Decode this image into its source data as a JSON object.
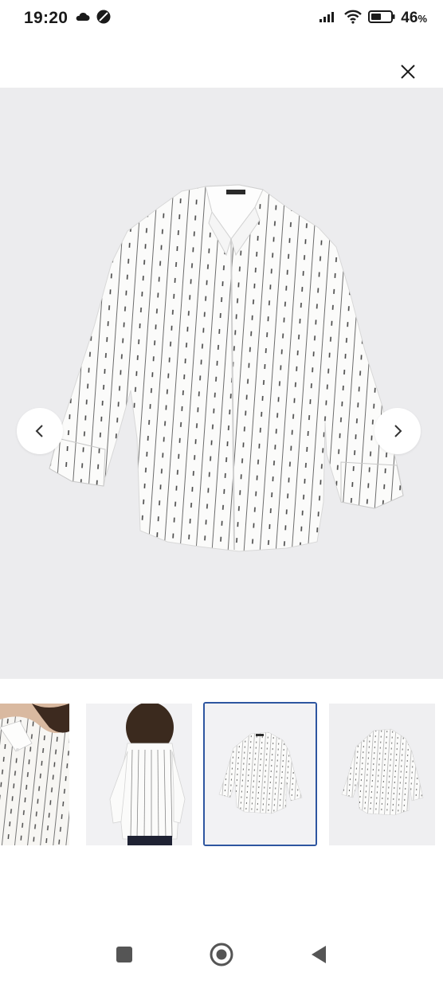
{
  "status_bar": {
    "time": "19:20",
    "battery_percent": "46",
    "battery_unit": "%"
  },
  "gallery": {
    "thumbnail_count": 4,
    "selected_thumbnail": 3
  },
  "colors": {
    "image_background": "#ececee",
    "selected_border": "#2e56a0",
    "icon_dark": "#1a1a1a"
  },
  "icons": {
    "close": "close-icon",
    "prev": "chevron-left-icon",
    "next": "chevron-right-icon",
    "home": "circle-icon",
    "recents": "square-icon",
    "back": "triangle-back-icon"
  }
}
